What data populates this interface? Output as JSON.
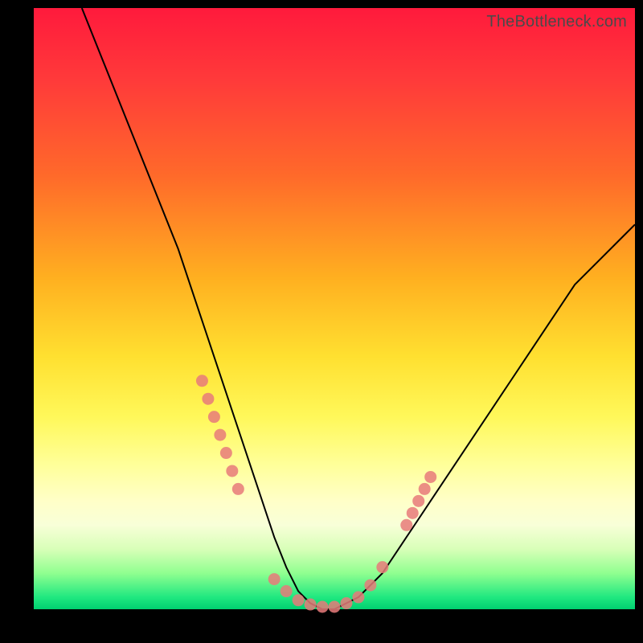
{
  "watermark": "TheBottleneck.com",
  "chart_data": {
    "type": "line",
    "title": "",
    "xlabel": "",
    "ylabel": "",
    "xlim": [
      0,
      100
    ],
    "ylim": [
      0,
      100
    ],
    "curve": {
      "name": "bottleneck-curve",
      "x": [
        8,
        12,
        16,
        20,
        24,
        28,
        30,
        32,
        34,
        36,
        38,
        40,
        42,
        44,
        46,
        48,
        50,
        54,
        58,
        62,
        66,
        70,
        74,
        78,
        82,
        86,
        90,
        94,
        98,
        100
      ],
      "y": [
        100,
        90,
        80,
        70,
        60,
        48,
        42,
        36,
        30,
        24,
        18,
        12,
        7,
        3,
        1,
        0,
        0,
        2,
        6,
        12,
        18,
        24,
        30,
        36,
        42,
        48,
        54,
        58,
        62,
        64
      ]
    },
    "markers": {
      "name": "data-points",
      "x": [
        28,
        29,
        30,
        31,
        32,
        33,
        34,
        40,
        42,
        44,
        46,
        48,
        50,
        52,
        54,
        56,
        58,
        62,
        63,
        64,
        65,
        66
      ],
      "y": [
        38,
        35,
        32,
        29,
        26,
        23,
        20,
        5,
        3,
        1.5,
        0.8,
        0.4,
        0.4,
        1,
        2,
        4,
        7,
        14,
        16,
        18,
        20,
        22
      ]
    },
    "background_gradient": {
      "top_color": "#ff1a3c",
      "mid_color": "#ffe030",
      "bottom_color": "#00d070"
    }
  }
}
